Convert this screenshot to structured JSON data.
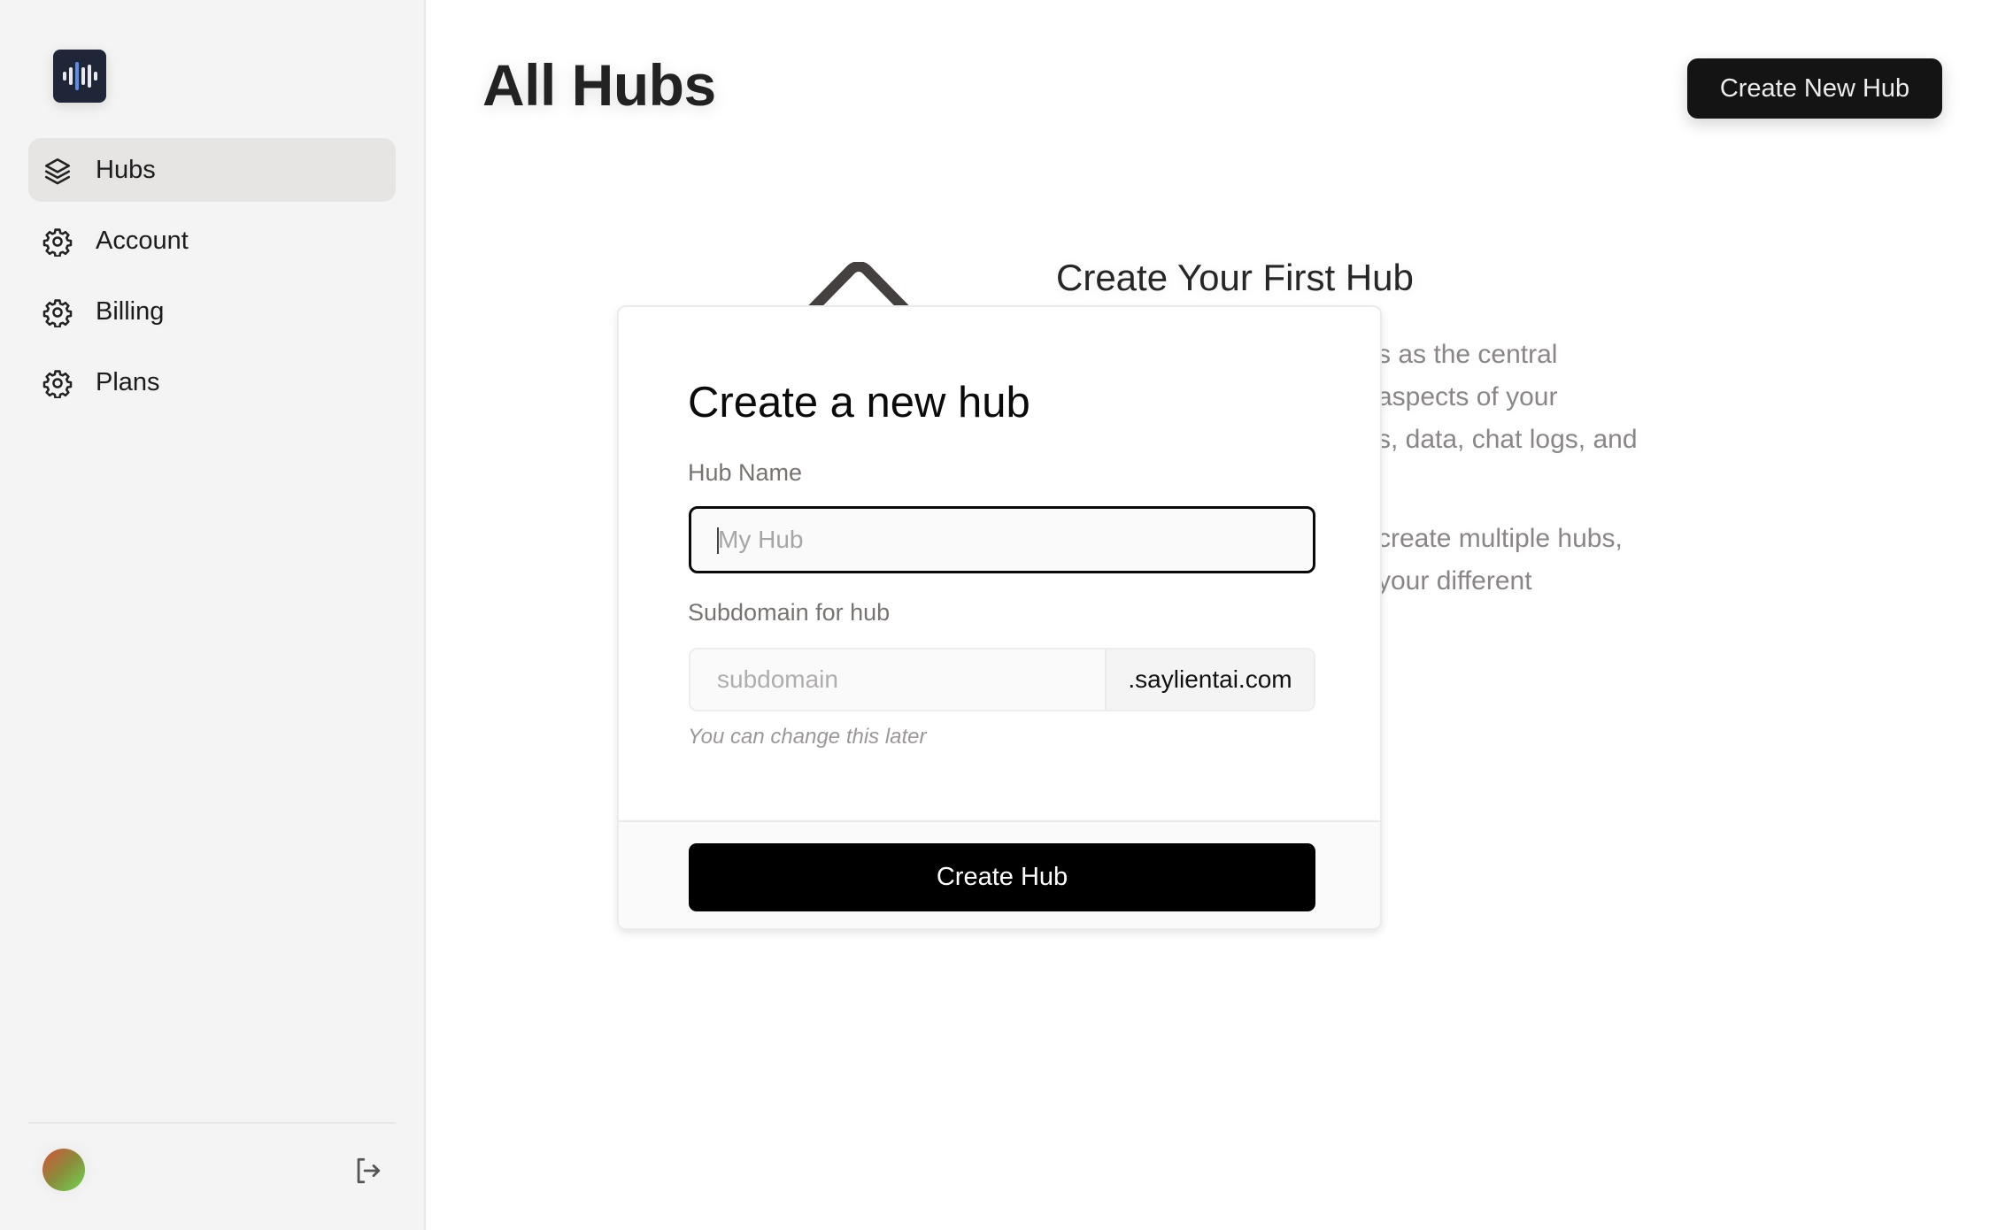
{
  "app": {
    "logo_icon": "audio-waveform-icon",
    "brand_colors": {
      "logo_bg": "#1f2638",
      "logo_accent": "#5a8ee6",
      "primary_button": "#141414"
    }
  },
  "sidebar": {
    "items": [
      {
        "label": "Hubs",
        "icon": "layers-icon",
        "active": true
      },
      {
        "label": "Account",
        "icon": "gear-icon",
        "active": false
      },
      {
        "label": "Billing",
        "icon": "gear-icon",
        "active": false
      },
      {
        "label": "Plans",
        "icon": "gear-icon",
        "active": false
      }
    ],
    "footer": {
      "avatar_icon": "user-avatar",
      "signout_icon": "sign-out-icon"
    }
  },
  "header": {
    "title": "All Hubs",
    "create_button_label": "Create New Hub"
  },
  "empty_state": {
    "illustration_icon": "layers-icon",
    "title": "Create Your First Hub",
    "visible_line_fragments": [
      "s as the central",
      "aspects of your",
      "s, data, chat logs, and",
      "create multiple hubs,",
      "your different"
    ]
  },
  "modal": {
    "title": "Create a new hub",
    "hub_name": {
      "label": "Hub Name",
      "value": "",
      "placeholder": "My Hub"
    },
    "subdomain": {
      "label": "Subdomain for hub",
      "value": "",
      "placeholder": "subdomain",
      "suffix": ".saylientai.com",
      "helper": "You can change this later"
    },
    "submit_label": "Create Hub"
  }
}
